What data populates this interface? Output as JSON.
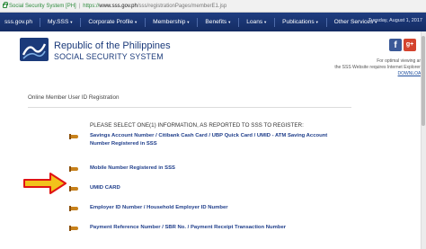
{
  "browser": {
    "site_identity": "Social Security System [PH]",
    "separator": "|",
    "url_scheme": "https://",
    "url_host": "www.sss.gov.ph",
    "url_path": "/sss/registrationPages/memberE1.jsp"
  },
  "nav": {
    "items": [
      {
        "label": "sss.gov.ph",
        "caret": false
      },
      {
        "label": "My.SSS",
        "caret": true
      },
      {
        "label": "Corporate Profile",
        "caret": true
      },
      {
        "label": "Membership",
        "caret": true
      },
      {
        "label": "Benefits",
        "caret": true
      },
      {
        "label": "Loans",
        "caret": true
      },
      {
        "label": "Publications",
        "caret": true
      },
      {
        "label": "Other Services",
        "caret": true
      }
    ],
    "caret_glyph": "▼",
    "date": "Tuesday, August 1, 2017"
  },
  "header": {
    "brand_line1": "Republic of the Philippines",
    "brand_line2": "SOCIAL SECURITY SYSTEM",
    "facebook_glyph": "f",
    "googleplus_glyph": "g+",
    "hint_line1": "For optimal viewing and",
    "hint_line2": "the SSS Website requires Internet Explorer 9",
    "hint_line3": "DOWNLOAD"
  },
  "content": {
    "section_title": "Online Member User ID Registration",
    "instruction": "PLEASE SELECT ONE(1) INFORMATION, AS REPORTED TO SSS TO REGISTER:",
    "options": [
      "Savings Account Number / Citibank Cash Card / UBP Quick Card / UMID - ATM Saving Account Number Registered in SSS",
      "Mobile Number Registered in SSS",
      "UMID CARD",
      "Employer ID Number / Household Employer ID Number",
      "Payment Reference Number / SBR No. / Payment Receipt Transaction Number"
    ]
  },
  "colors": {
    "nav_bg": "#1a3570",
    "brand_text": "#1b3a7a",
    "option_link": "#1e3d8a",
    "arrow_fill": "#f2c21b",
    "arrow_outline": "#e01414"
  }
}
